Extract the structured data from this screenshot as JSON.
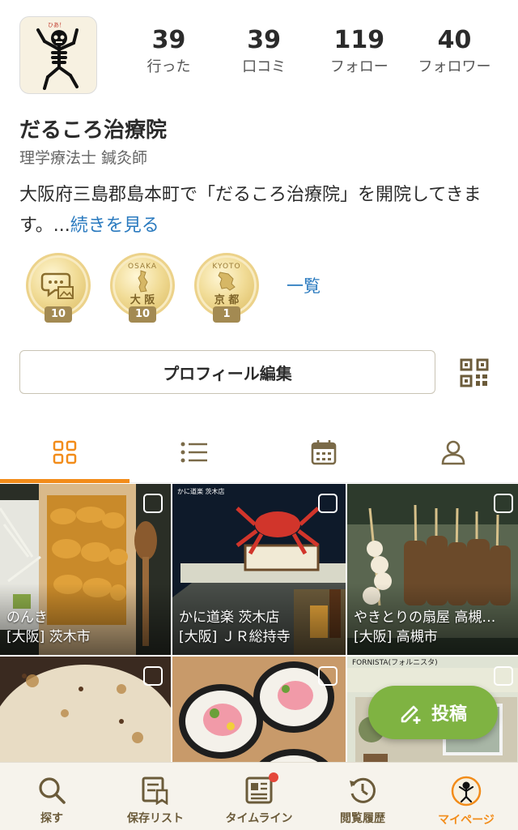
{
  "profile": {
    "name": "だるころ治療院",
    "title": "理学療法士 鍼灸師",
    "bio": "大阪府三島郡島本町で「だるころ治療院」を開院してきます。...",
    "bio_more": "続きを見る",
    "avatar_icon": "skeleton-dancing-icon",
    "avatar_small_text": "ひあ！"
  },
  "stats": [
    {
      "value": "39",
      "label": "行った"
    },
    {
      "value": "39",
      "label": "口コミ"
    },
    {
      "value": "119",
      "label": "フォロー"
    },
    {
      "value": "40",
      "label": "フォロワー"
    }
  ],
  "badges": [
    {
      "icon": "review-photo-icon",
      "top_text": "",
      "mid_text": "",
      "count": "10"
    },
    {
      "icon": "osaka-map-icon",
      "top_text": "OSAKA",
      "mid_text": "大 阪",
      "count": "10"
    },
    {
      "icon": "kyoto-map-icon",
      "top_text": "KYOTO",
      "mid_text": "京 都",
      "count": "1"
    }
  ],
  "badge_list_link": "一覧",
  "edit_profile_label": "プロフィール編集",
  "tabs": [
    {
      "icon": "grid-icon",
      "active": true
    },
    {
      "icon": "list-icon",
      "active": false
    },
    {
      "icon": "calendar-icon",
      "active": false
    },
    {
      "icon": "person-icon",
      "active": false
    }
  ],
  "posts": [
    {
      "name": "のんき",
      "area": "[大阪] 茨木市",
      "sign": ""
    },
    {
      "name": "かに道楽 茨木店",
      "area": "[大阪] ＪＲ総持寺",
      "sign": "かに道楽 茨木店"
    },
    {
      "name": "やきとりの扇屋 高槻…",
      "area": "[大阪] 高槻市",
      "sign": ""
    },
    {
      "name": "",
      "area": "",
      "sign": ""
    },
    {
      "name": "",
      "area": "",
      "sign": ""
    },
    {
      "name": "",
      "area": "",
      "sign": "FORNISTA(フォルニスタ)"
    }
  ],
  "post_button_label": "投稿",
  "nav": [
    {
      "label": "探す",
      "icon": "search-icon",
      "active": false
    },
    {
      "label": "保存リスト",
      "icon": "saved-list-icon",
      "active": false
    },
    {
      "label": "タイムライン",
      "icon": "timeline-icon",
      "active": false,
      "notification": true
    },
    {
      "label": "閲覧履歴",
      "icon": "history-icon",
      "active": false
    },
    {
      "label": "マイページ",
      "icon": "mypage-avatar-icon",
      "active": true
    }
  ],
  "colors": {
    "accent": "#f28c1a",
    "link": "#2a7abf",
    "post_button": "#7fb342",
    "badge_gold": "#e8cf85",
    "notification": "#e4473a"
  }
}
